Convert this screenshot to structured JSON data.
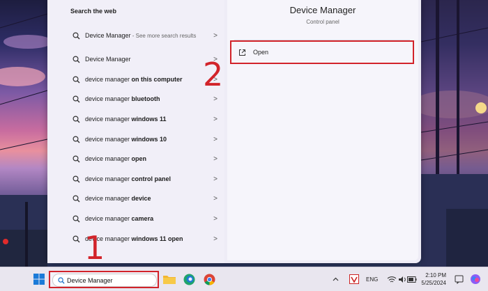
{
  "search_panel": {
    "section_title": "Search the web",
    "results": [
      {
        "prefix": "Device Manager",
        "bold": "",
        "sub": " - See more search results"
      },
      {
        "prefix": "Device Manager",
        "bold": "",
        "sub": ""
      },
      {
        "prefix": "device manager ",
        "bold": "on this computer",
        "sub": ""
      },
      {
        "prefix": "device manager ",
        "bold": "bluetooth",
        "sub": ""
      },
      {
        "prefix": "device manager ",
        "bold": "windows 11",
        "sub": ""
      },
      {
        "prefix": "device manager ",
        "bold": "windows 10",
        "sub": ""
      },
      {
        "prefix": "device manager ",
        "bold": "open",
        "sub": ""
      },
      {
        "prefix": "device manager ",
        "bold": "control panel",
        "sub": ""
      },
      {
        "prefix": "device manager ",
        "bold": "device",
        "sub": ""
      },
      {
        "prefix": "device manager ",
        "bold": "camera",
        "sub": ""
      },
      {
        "prefix": "device manager ",
        "bold": "windows 11 open",
        "sub": ""
      }
    ],
    "chevron": ">"
  },
  "preview": {
    "app_title": "Device Manager",
    "app_subtitle": "Control panel",
    "open_label": "Open"
  },
  "annotations": {
    "step1": "1",
    "step2": "2",
    "highlight_color": "#d2232a"
  },
  "taskbar": {
    "search_value": "Device Manager",
    "icons": [
      "windows-start-icon",
      "file-explorer-icon",
      "edge-icon",
      "chrome-icon"
    ],
    "tray": {
      "language": "ENG",
      "time": "2:10 PM",
      "date": "5/25/2024"
    }
  }
}
